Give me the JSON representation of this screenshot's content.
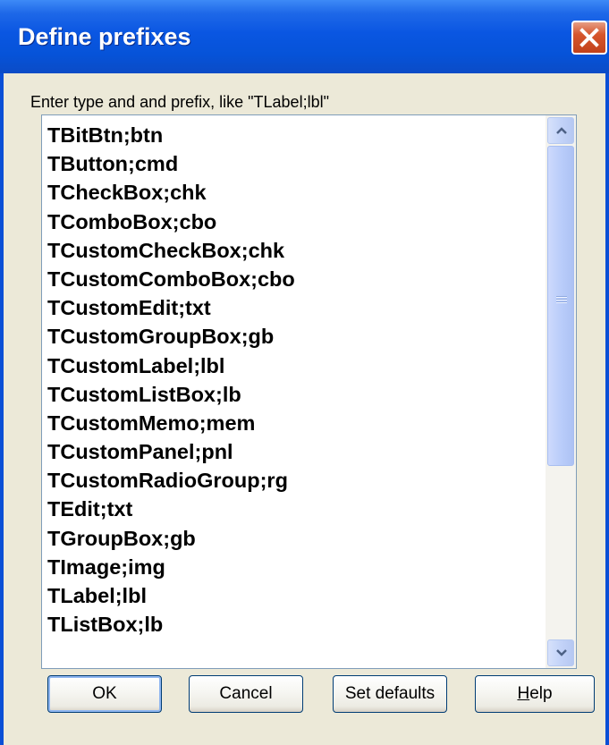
{
  "window": {
    "title": "Define prefixes",
    "close_icon": "close-icon"
  },
  "instruction": "Enter type and and prefix, like \"TLabel;lbl\"",
  "prefixes": [
    "TBitBtn;btn",
    "TButton;cmd",
    "TCheckBox;chk",
    "TComboBox;cbo",
    "TCustomCheckBox;chk",
    "TCustomComboBox;cbo",
    "TCustomEdit;txt",
    "TCustomGroupBox;gb",
    "TCustomLabel;lbl",
    "TCustomListBox;lb",
    "TCustomMemo;mem",
    "TCustomPanel;pnl",
    "TCustomRadioGroup;rg",
    "TEdit;txt",
    "TGroupBox;gb",
    "TImage;img",
    "TLabel;lbl",
    "TListBox;lb"
  ],
  "buttons": {
    "ok": "OK",
    "cancel": "Cancel",
    "set_defaults": "Set defaults",
    "help_hotkey": "H",
    "help_rest": "elp"
  },
  "colors": {
    "titlebar": "#0a56e2",
    "close_button": "#d6552c",
    "dialog_face": "#ece9d8",
    "scrollbar": "#c3d3f8"
  }
}
